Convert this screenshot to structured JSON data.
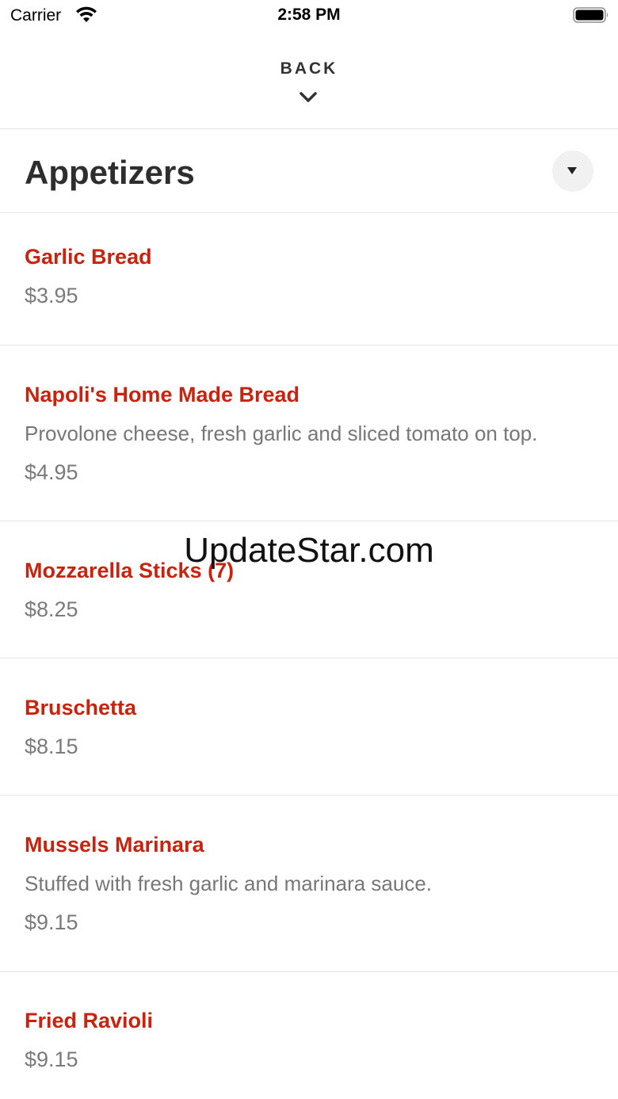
{
  "status_bar": {
    "carrier": "Carrier",
    "time": "2:58 PM"
  },
  "header": {
    "back_label": "BACK"
  },
  "category": {
    "title": "Appetizers"
  },
  "menu_items": [
    {
      "name": "Garlic Bread",
      "description": "",
      "price": "$3.95"
    },
    {
      "name": "Napoli's Home Made Bread",
      "description": "Provolone cheese, fresh garlic and sliced tomato on top.",
      "price": "$4.95"
    },
    {
      "name": "Mozzarella Sticks (7)",
      "description": "",
      "price": "$8.25"
    },
    {
      "name": "Bruschetta",
      "description": "",
      "price": "$8.15"
    },
    {
      "name": "Mussels Marinara",
      "description": "Stuffed with fresh garlic and marinara sauce.",
      "price": "$9.15"
    },
    {
      "name": "Fried Ravioli",
      "description": "",
      "price": "$9.15"
    }
  ],
  "watermark": "UpdateStar.com",
  "colors": {
    "item_name": "#c8230e",
    "price": "#7a7a7a",
    "divider": "#e6e6e6"
  }
}
